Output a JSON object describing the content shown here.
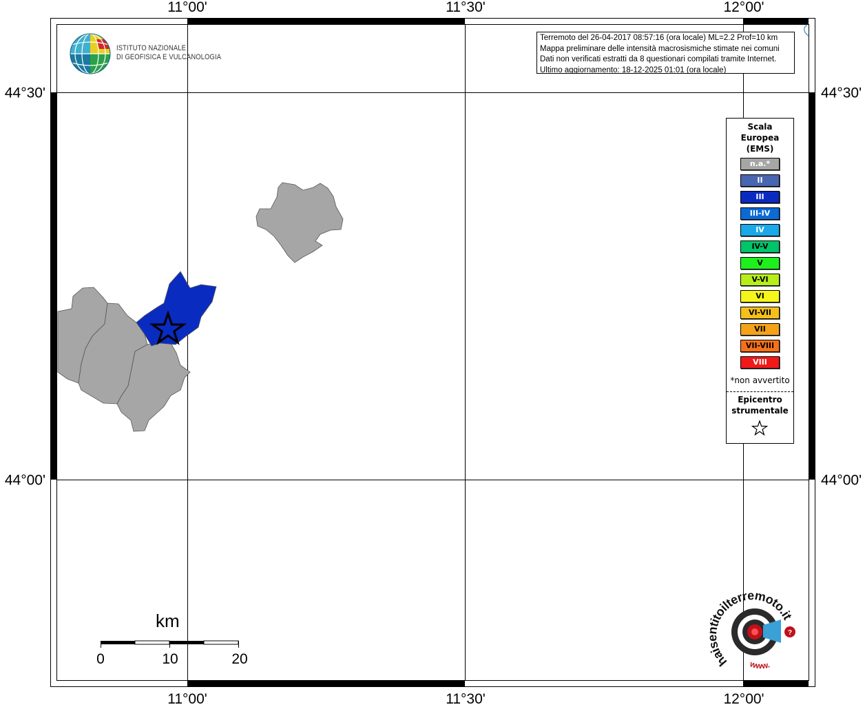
{
  "graticule": {
    "lon_labels": [
      "11°00'",
      "11°30'",
      "12°00'"
    ],
    "lat_labels": [
      "44°30'",
      "44°00'"
    ]
  },
  "info_box": {
    "lines": [
      "Terremoto del 26-04-2017 08:57:16 (ora locale) ML=2.2 Prof=10 km",
      "Mappa preliminare delle intensità macrosismiche stimate nei comuni",
      "Dati non verificati estratti da 8 questionari compilati tramite Internet.",
      "Ultimo aggiornamento: 18-12-2025 01:01 (ora locale)"
    ]
  },
  "logo": {
    "line1": "ISTITUTO NAZIONALE",
    "line2": "DI GEOFISICA E VULCANOLOGIA",
    "icon": "ingv-globe-icon"
  },
  "legend": {
    "title_line1": "Scala",
    "title_line2": "Europea",
    "title_line3": "(EMS)",
    "items": [
      {
        "label": "n.a.*",
        "color": "#a6a6a6",
        "text_color": "#ffffff"
      },
      {
        "label": "II",
        "color": "#4a66b0",
        "text_color": "#ffffff"
      },
      {
        "label": "III",
        "color": "#0a2bc0",
        "text_color": "#ffffff"
      },
      {
        "label": "III-IV",
        "color": "#0a6ad6",
        "text_color": "#ffffff"
      },
      {
        "label": "IV",
        "color": "#1aa8e8",
        "text_color": "#ffffff"
      },
      {
        "label": "IV-V",
        "color": "#00c46a",
        "text_color": "#000000"
      },
      {
        "label": "V",
        "color": "#1ef01e",
        "text_color": "#000000"
      },
      {
        "label": "V-VI",
        "color": "#b6ee1a",
        "text_color": "#000000"
      },
      {
        "label": "VI",
        "color": "#f5f51a",
        "text_color": "#000000"
      },
      {
        "label": "VI-VII",
        "color": "#f5c01a",
        "text_color": "#000000"
      },
      {
        "label": "VII",
        "color": "#f5a21a",
        "text_color": "#000000"
      },
      {
        "label": "VII-VIII",
        "color": "#f5701a",
        "text_color": "#000000"
      },
      {
        "label": "VIII",
        "color": "#f01a1a",
        "text_color": "#ffffff"
      }
    ],
    "note": "*non avvertito",
    "epicenter_line1": "Epicentro",
    "epicenter_line2": "strumentale",
    "epicenter_icon": "star-icon"
  },
  "map": {
    "intensity_area_color": "#0a2bc0",
    "not_available_color": "#a6a6a6"
  },
  "scale_bar": {
    "unit": "km",
    "labels": [
      "0",
      "10",
      "20"
    ]
  },
  "watermark": {
    "text": "haisentitoilterremoto.it",
    "url_text": "www.",
    "icon": "haisentito-logo-icon"
  }
}
